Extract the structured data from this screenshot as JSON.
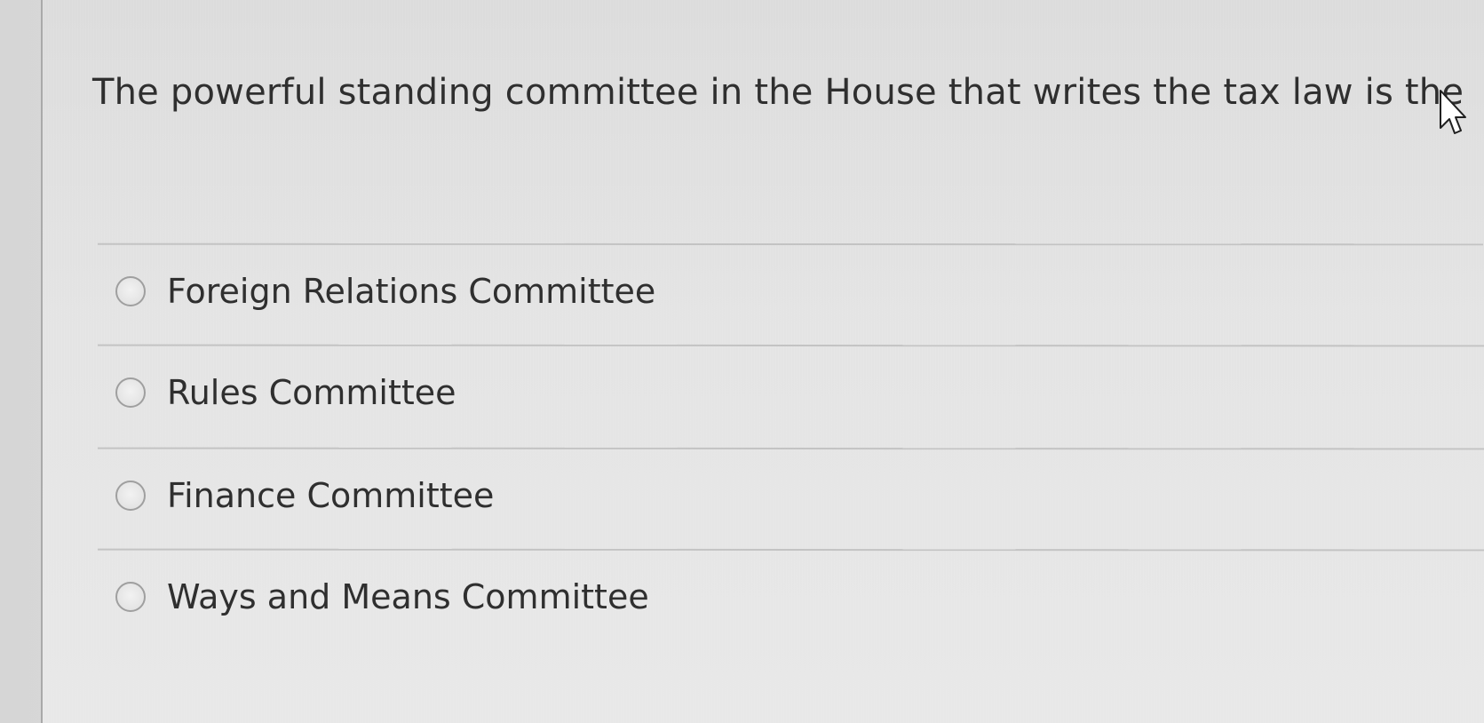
{
  "question": {
    "text": "The powerful standing committee in the House that writes the tax law is the"
  },
  "answers": [
    {
      "label": "Foreign Relations Committee"
    },
    {
      "label": "Rules Committee"
    },
    {
      "label": "Finance Committee"
    },
    {
      "label": "Ways and Means Committee"
    }
  ],
  "icons": {
    "radio": "radio-button-icon",
    "cursor": "mouse-pointer-icon"
  },
  "colors": {
    "text": "#2f2f2f",
    "background": "#e3e3e3",
    "divider": "#c3c3c3",
    "radio_border": "#9f9f9f"
  }
}
